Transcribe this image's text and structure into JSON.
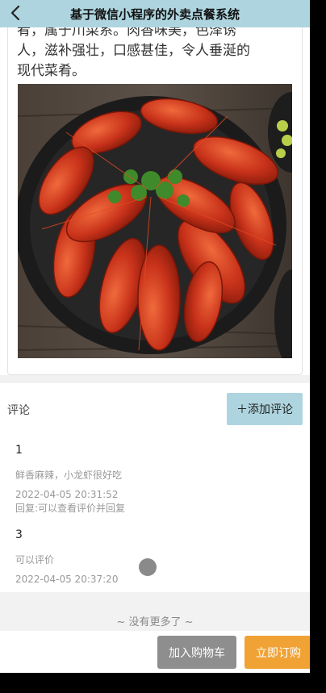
{
  "header": {
    "title": "基于微信小程序的外卖点餐系统",
    "back_icon": "chevron-left-icon"
  },
  "dish": {
    "description_lines": [
      "肴，属于川菜系。肉香味美，色泽诱",
      "人，滋补强壮，口感甚佳，令人垂涎的",
      "现代菜肴。"
    ],
    "image": "crayfish-dish-photo"
  },
  "reviews": {
    "label": "评论",
    "add_button": "＋添加评论",
    "items": [
      {
        "user": "1",
        "text": "鲜香麻辣，小龙虾很好吃",
        "time": "2022-04-05 20:31:52",
        "reply": "回复:可以查看评价并回复"
      },
      {
        "user": "3",
        "text": "可以评价",
        "time": "2022-04-05 20:37:20"
      }
    ],
    "no_more": "~ 没有更多了 ~"
  },
  "actions": {
    "add_to_cart": "加入购物车",
    "buy_now": "立即订购"
  },
  "colors": {
    "header_bg": "#aed5df",
    "cart_btn": "#8e8e8e",
    "buy_btn": "#f0a235"
  }
}
